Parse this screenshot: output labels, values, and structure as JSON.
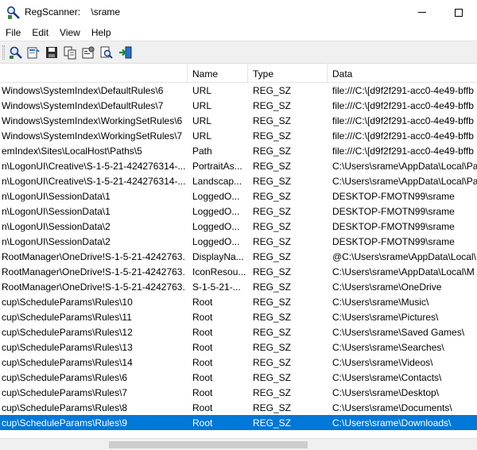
{
  "window": {
    "title": "RegScanner:    \\srame"
  },
  "menu": [
    "File",
    "Edit",
    "View",
    "Help"
  ],
  "toolbar": {
    "buttons": [
      {
        "name": "scan-icon"
      },
      {
        "name": "export-icon"
      },
      {
        "name": "save-icon"
      },
      {
        "name": "copy-icon"
      },
      {
        "name": "properties-icon"
      },
      {
        "name": "find-icon"
      },
      {
        "name": "exit-icon"
      }
    ]
  },
  "columns": {
    "path": "",
    "name": "Name",
    "type": "Type",
    "data": "Data"
  },
  "rows": [
    {
      "path": "Windows\\SystemIndex\\DefaultRules\\6",
      "name": "URL",
      "type": "REG_SZ",
      "data": "file:///C:\\[d9f2f291-acc0-4e49-bffb"
    },
    {
      "path": "Windows\\SystemIndex\\DefaultRules\\7",
      "name": "URL",
      "type": "REG_SZ",
      "data": "file:///C:\\[d9f2f291-acc0-4e49-bffb"
    },
    {
      "path": "Windows\\SystemIndex\\WorkingSetRules\\6",
      "name": "URL",
      "type": "REG_SZ",
      "data": "file:///C:\\[d9f2f291-acc0-4e49-bffb"
    },
    {
      "path": "Windows\\SystemIndex\\WorkingSetRules\\7",
      "name": "URL",
      "type": "REG_SZ",
      "data": "file:///C:\\[d9f2f291-acc0-4e49-bffb"
    },
    {
      "path": "emIndex\\Sites\\LocalHost\\Paths\\5",
      "name": "Path",
      "type": "REG_SZ",
      "data": "file:///C:\\[d9f2f291-acc0-4e49-bffb"
    },
    {
      "path": "n\\LogonUI\\Creative\\S-1-5-21-424276314-...",
      "name": "PortraitAs...",
      "type": "REG_SZ",
      "data": "C:\\Users\\srame\\AppData\\Local\\Pa"
    },
    {
      "path": "n\\LogonUI\\Creative\\S-1-5-21-424276314-...",
      "name": "Landscap...",
      "type": "REG_SZ",
      "data": "C:\\Users\\srame\\AppData\\Local\\Pa"
    },
    {
      "path": "n\\LogonUI\\SessionData\\1",
      "name": "LoggedO...",
      "type": "REG_SZ",
      "data": "DESKTOP-FMOTN99\\srame"
    },
    {
      "path": "n\\LogonUI\\SessionData\\1",
      "name": "LoggedO...",
      "type": "REG_SZ",
      "data": "DESKTOP-FMOTN99\\srame"
    },
    {
      "path": "n\\LogonUI\\SessionData\\2",
      "name": "LoggedO...",
      "type": "REG_SZ",
      "data": "DESKTOP-FMOTN99\\srame"
    },
    {
      "path": "n\\LogonUI\\SessionData\\2",
      "name": "LoggedO...",
      "type": "REG_SZ",
      "data": "DESKTOP-FMOTN99\\srame"
    },
    {
      "path": "RootManager\\OneDrive!S-1-5-21-4242763...",
      "name": "DisplayNa...",
      "type": "REG_SZ",
      "data": "@C:\\Users\\srame\\AppData\\Local\\"
    },
    {
      "path": "RootManager\\OneDrive!S-1-5-21-4242763...",
      "name": "IconResou...",
      "type": "REG_SZ",
      "data": "C:\\Users\\srame\\AppData\\Local\\M"
    },
    {
      "path": "RootManager\\OneDrive!S-1-5-21-4242763...",
      "name": "S-1-5-21-...",
      "type": "REG_SZ",
      "data": "C:\\Users\\srame\\OneDrive"
    },
    {
      "path": "cup\\ScheduleParams\\Rules\\10",
      "name": "Root",
      "type": "REG_SZ",
      "data": "C:\\Users\\srame\\Music\\"
    },
    {
      "path": "cup\\ScheduleParams\\Rules\\11",
      "name": "Root",
      "type": "REG_SZ",
      "data": "C:\\Users\\srame\\Pictures\\"
    },
    {
      "path": "cup\\ScheduleParams\\Rules\\12",
      "name": "Root",
      "type": "REG_SZ",
      "data": "C:\\Users\\srame\\Saved Games\\"
    },
    {
      "path": "cup\\ScheduleParams\\Rules\\13",
      "name": "Root",
      "type": "REG_SZ",
      "data": "C:\\Users\\srame\\Searches\\"
    },
    {
      "path": "cup\\ScheduleParams\\Rules\\14",
      "name": "Root",
      "type": "REG_SZ",
      "data": "C:\\Users\\srame\\Videos\\"
    },
    {
      "path": "cup\\ScheduleParams\\Rules\\6",
      "name": "Root",
      "type": "REG_SZ",
      "data": "C:\\Users\\srame\\Contacts\\"
    },
    {
      "path": "cup\\ScheduleParams\\Rules\\7",
      "name": "Root",
      "type": "REG_SZ",
      "data": "C:\\Users\\srame\\Desktop\\"
    },
    {
      "path": "cup\\ScheduleParams\\Rules\\8",
      "name": "Root",
      "type": "REG_SZ",
      "data": "C:\\Users\\srame\\Documents\\"
    },
    {
      "path": "cup\\ScheduleParams\\Rules\\9",
      "name": "Root",
      "type": "REG_SZ",
      "data": "C:\\Users\\srame\\Downloads\\",
      "selected": true
    }
  ],
  "colors": {
    "selection": "#0078d7",
    "toolbar_bg": "#f0f0f0"
  }
}
